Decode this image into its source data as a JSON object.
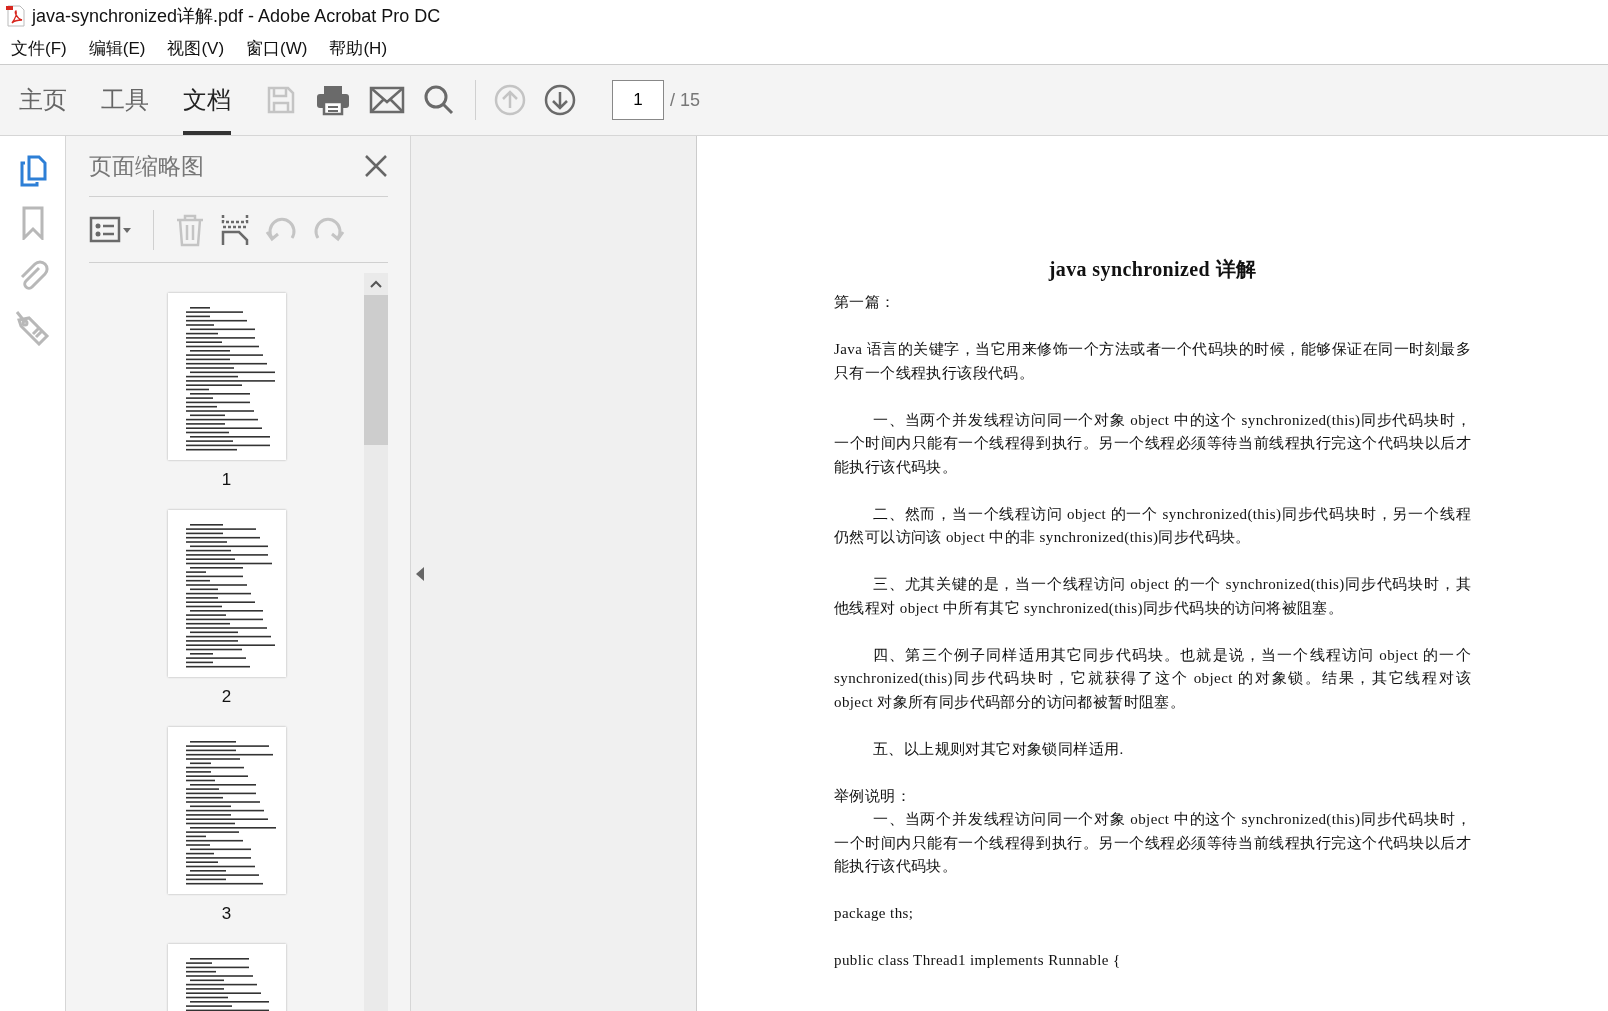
{
  "window": {
    "title": "java-synchronized详解.pdf - Adobe Acrobat Pro DC"
  },
  "menu": [
    "文件(F)",
    "编辑(E)",
    "视图(V)",
    "窗口(W)",
    "帮助(H)"
  ],
  "tabs": [
    {
      "label": "主页",
      "selected": false
    },
    {
      "label": "工具",
      "selected": false
    },
    {
      "label": "文档",
      "selected": true
    }
  ],
  "toolbar_buttons": [
    {
      "kind": "save",
      "disabled": true
    },
    {
      "kind": "print",
      "disabled": false
    },
    {
      "kind": "mail",
      "disabled": false
    },
    {
      "kind": "search",
      "disabled": false
    },
    {
      "kind": "up",
      "disabled": true
    },
    {
      "kind": "down",
      "disabled": false
    }
  ],
  "page_field": {
    "value": "1",
    "total": "/ 15"
  },
  "rail": [
    {
      "kind": "pages",
      "selected": true
    },
    {
      "kind": "bookmark",
      "selected": false
    },
    {
      "kind": "attachment",
      "selected": false
    },
    {
      "kind": "tag",
      "selected": false
    }
  ],
  "panel": {
    "title": "页面缩略图",
    "tools": [
      {
        "kind": "options",
        "disabled": false
      },
      {
        "kind": "delete",
        "disabled": true
      },
      {
        "kind": "insert",
        "disabled": false
      },
      {
        "kind": "rotate_left",
        "disabled": true
      },
      {
        "kind": "rotate_right",
        "disabled": true
      }
    ],
    "thumbnails": [
      {
        "kind": "full",
        "label": "1"
      },
      {
        "kind": "full",
        "label": "2"
      },
      {
        "kind": "full",
        "label": "3"
      },
      {
        "kind": "partial"
      }
    ]
  },
  "document": {
    "paragraphs": [
      {
        "kind": "title",
        "text": "java synchronized 详解"
      },
      {
        "kind": "plain",
        "text": "第一篇："
      },
      {
        "kind": "plain",
        "text": "Java 语言的关键字，当它用来修饰一个方法或者一个代码块的时候，能够保证在同一时刻最多只有一个线程执行该段代码。"
      },
      {
        "kind": "indented",
        "text": "一、当两个并发线程访问同一个对象 object 中的这个 synchronized(this)同步代码块时，一个时间内只能有一个线程得到执行。另一个线程必须等待当前线程执行完这个代码块以后才能执行该代码块。"
      },
      {
        "kind": "indented",
        "text": "二、然而，当一个线程访问 object 的一个 synchronized(this)同步代码块时，另一个线程仍然可以访问该 object 中的非 synchronized(this)同步代码块。"
      },
      {
        "kind": "indented",
        "text": "三、尤其关键的是，当一个线程访问 object 的一个 synchronized(this)同步代码块时，其他线程对 object 中所有其它 synchronized(this)同步代码块的访问将被阻塞。"
      },
      {
        "kind": "indented",
        "text": "四、第三个例子同样适用其它同步代码块。也就是说，当一个线程访问 object 的一个 synchronized(this)同步代码块时，它就获得了这个 object 的对象锁。结果，其它线程对该 object 对象所有同步代码部分的访问都被暂时阻塞。"
      },
      {
        "kind": "indented",
        "text": "五、以上规则对其它对象锁同样适用."
      },
      {
        "kind": "plain",
        "text": "举例说明："
      },
      {
        "kind": "continued",
        "text": "一、当两个并发线程访问同一个对象 object 中的这个 synchronized(this)同步代码块时，一个时间内只能有一个线程得到执行。另一个线程必须等待当前线程执行完这个代码块以后才能执行该代码块。"
      },
      {
        "kind": "plain",
        "text": "package ths;"
      },
      {
        "kind": "plain",
        "text": "public class Thread1 implements Runnable {"
      }
    ]
  }
}
